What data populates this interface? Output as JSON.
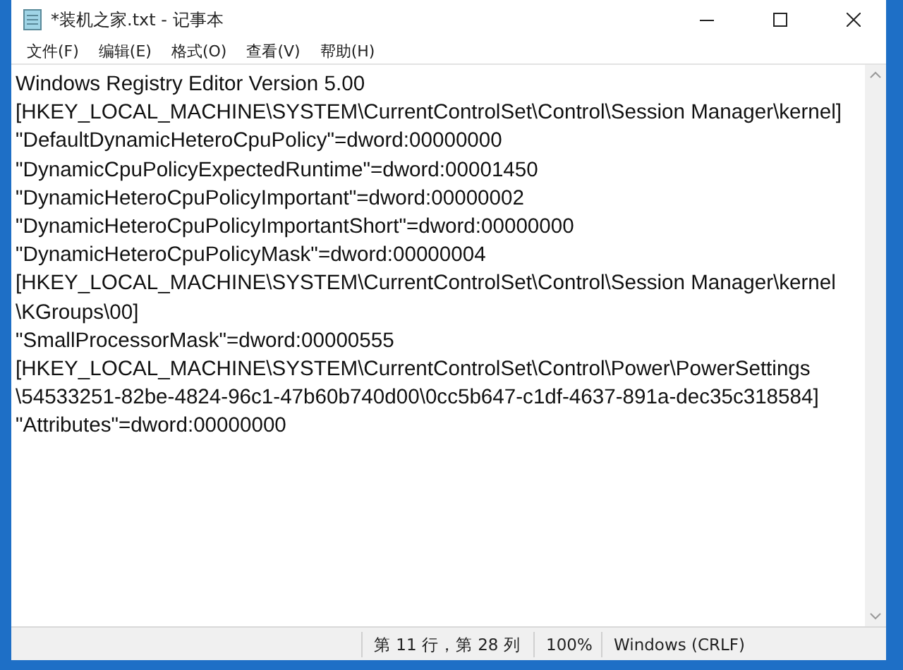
{
  "window": {
    "title": "*装机之家.txt - 记事本"
  },
  "menu": [
    "文件(F)",
    "编辑(E)",
    "格式(O)",
    "查看(V)",
    "帮助(H)"
  ],
  "lines": [
    "Windows Registry Editor Version 5.00",
    "[HKEY_LOCAL_MACHINE\\SYSTEM\\CurrentControlSet\\Control\\Session Manager\\kernel]",
    "\"DefaultDynamicHeteroCpuPolicy\"=dword:00000000",
    "\"DynamicCpuPolicyExpectedRuntime\"=dword:00001450",
    "\"DynamicHeteroCpuPolicyImportant\"=dword:00000002",
    "\"DynamicHeteroCpuPolicyImportantShort\"=dword:00000000",
    "\"DynamicHeteroCpuPolicyMask\"=dword:00000004",
    "[HKEY_LOCAL_MACHINE\\SYSTEM\\CurrentControlSet\\Control\\Session Manager\\kernel",
    "\\KGroups\\00]",
    "\"SmallProcessorMask\"=dword:00000555",
    "[HKEY_LOCAL_MACHINE\\SYSTEM\\CurrentControlSet\\Control\\Power\\PowerSettings",
    "\\54533251-82be-4824-96c1-47b60b740d00\\0cc5b647-c1df-4637-891a-dec35c318584]",
    "\"Attributes\"=dword:00000000"
  ],
  "status_bar": {
    "position": "第 11 行，第 28 列",
    "zoom": "100%",
    "line_ending": "Windows (CRLF)"
  }
}
